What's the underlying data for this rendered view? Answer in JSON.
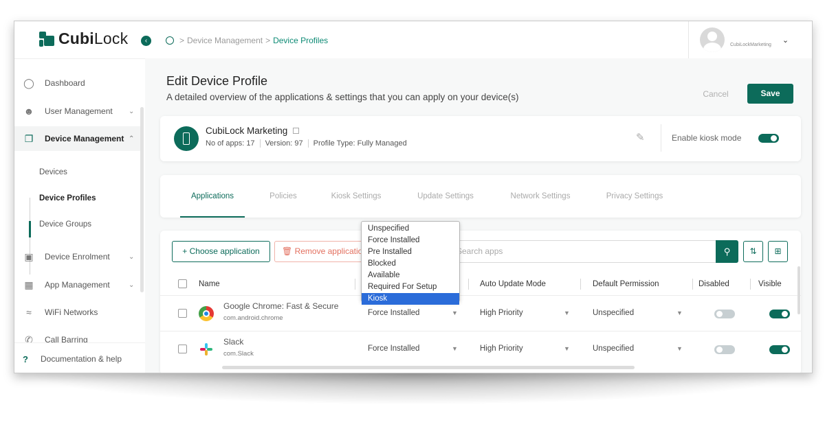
{
  "app": {
    "logo_prefix": "Cubi",
    "logo_suffix": "Lock"
  },
  "breadcrumb": {
    "parent": "Device Management",
    "separator": ">",
    "current": "Device Profiles"
  },
  "user": {
    "name": "CubiLockMarketing"
  },
  "sidebar": {
    "items": [
      {
        "label": "Dashboard",
        "icon": "dashboard-icon"
      },
      {
        "label": "User Management",
        "icon": "users-icon"
      },
      {
        "label": "Device Management",
        "icon": "devices-icon"
      },
      {
        "label": "Device Enrolment",
        "icon": "monitor-icon"
      },
      {
        "label": "App Management",
        "icon": "apps-grid-icon"
      },
      {
        "label": "WiFi Networks",
        "icon": "wifi-icon"
      },
      {
        "label": "Call Barring",
        "icon": "phone-icon"
      }
    ],
    "sub_items": [
      "Devices",
      "Device Profiles",
      "Device Groups"
    ],
    "footer": "Documentation & help"
  },
  "page": {
    "title": "Edit Device Profile",
    "subtitle": "A detailed overview of the applications & settings that you can apply on your device(s)",
    "cancel": "Cancel",
    "save": "Save"
  },
  "profile": {
    "name": "CubiLock Marketing",
    "apps": "No of apps: 17",
    "version": "Version: 97",
    "type": "Profile Type: Fully Managed",
    "kiosk_label": "Enable kiosk mode",
    "kiosk_enabled": true
  },
  "tabs": [
    "Applications",
    "Policies",
    "Kiosk Settings",
    "Update Settings",
    "Network Settings",
    "Privacy Settings"
  ],
  "apps_toolbar": {
    "choose": "+ Choose application",
    "remove": "Remove application",
    "search_placeholder": "Search apps"
  },
  "table": {
    "columns": [
      "Name",
      "Auto Update Mode",
      "Default Permission",
      "Disabled",
      "Visible"
    ],
    "rows": [
      {
        "name": "Google Chrome: Fast & Secure",
        "package": "com.android.chrome",
        "install": "Force Installed",
        "update": "High Priority",
        "permission": "Unspecified",
        "disabled": false,
        "visible": true
      },
      {
        "name": "Slack",
        "package": "com.Slack",
        "install": "Force Installed",
        "update": "High Priority",
        "permission": "Unspecified",
        "disabled": false,
        "visible": true
      }
    ]
  },
  "install_dropdown": {
    "options": [
      "Unspecified",
      "Force Installed",
      "Pre Installed",
      "Blocked",
      "Available",
      "Required For Setup",
      "Kiosk"
    ],
    "highlighted": "Kiosk"
  },
  "colors": {
    "brand": "#0c6b5a",
    "danger": "#e3705f",
    "highlight": "#2b6cd9"
  }
}
